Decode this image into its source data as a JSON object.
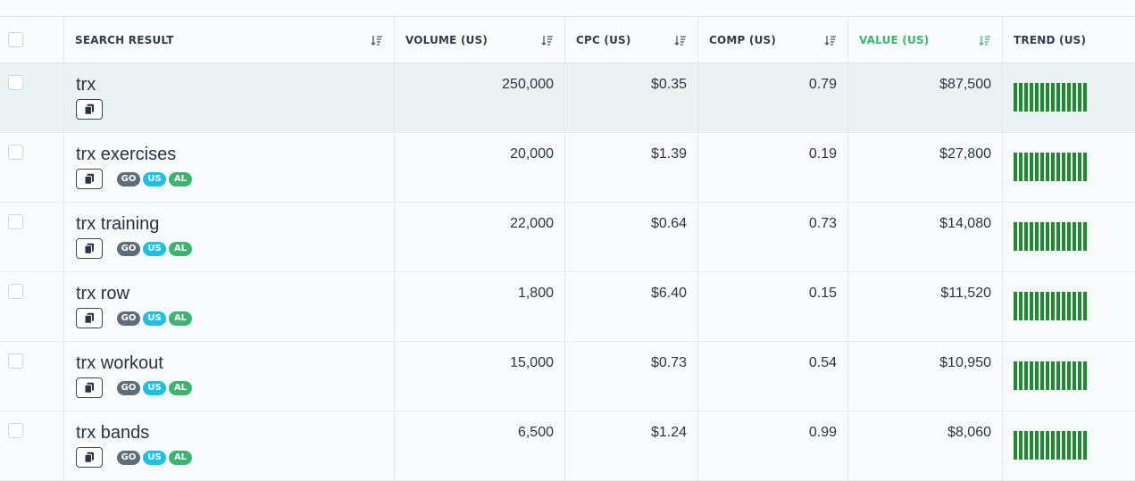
{
  "header": {
    "keyword": "SEARCH RESULT",
    "volume": "VOLUME (US)",
    "cpc": "CPC (US)",
    "comp": "COMP (US)",
    "value": "VALUE (US)",
    "trend": "TREND (US)"
  },
  "badge_labels": [
    "GO",
    "US",
    "AL"
  ],
  "colors": {
    "accent_green": "#3cb470",
    "trend_bar": "#1e8a2f",
    "badge_go": "#5f6d79",
    "badge_us": "#19c1e3",
    "badge_al": "#3cb470",
    "highlight_row": "#ecf2f4"
  },
  "rows": [
    {
      "keyword": "trx",
      "volume": "250,000",
      "cpc": "$0.35",
      "comp": "0.79",
      "value": "$87,500",
      "badges": false,
      "highlighted": true,
      "trend": [
        1,
        1,
        1,
        1,
        1,
        1,
        1,
        1,
        1,
        1,
        1,
        1,
        1,
        1
      ]
    },
    {
      "keyword": "trx exercises",
      "volume": "20,000",
      "cpc": "$1.39",
      "comp": "0.19",
      "value": "$27,800",
      "badges": true,
      "highlighted": false,
      "trend": [
        1,
        1,
        1,
        1,
        1,
        1,
        1,
        1,
        1,
        1,
        1,
        1,
        1,
        1
      ]
    },
    {
      "keyword": "trx training",
      "volume": "22,000",
      "cpc": "$0.64",
      "comp": "0.73",
      "value": "$14,080",
      "badges": true,
      "highlighted": false,
      "trend": [
        1,
        1,
        1,
        1,
        1,
        1,
        1,
        1,
        1,
        1,
        1,
        1,
        1,
        1
      ]
    },
    {
      "keyword": "trx row",
      "volume": "1,800",
      "cpc": "$6.40",
      "comp": "0.15",
      "value": "$11,520",
      "badges": true,
      "highlighted": false,
      "trend": [
        1,
        1,
        1,
        1,
        1,
        1,
        1,
        1,
        1,
        1,
        1,
        1,
        1,
        1
      ]
    },
    {
      "keyword": "trx workout",
      "volume": "15,000",
      "cpc": "$0.73",
      "comp": "0.54",
      "value": "$10,950",
      "badges": true,
      "highlighted": false,
      "trend": [
        1,
        1,
        1,
        1,
        1,
        1,
        1,
        1,
        1,
        1,
        1,
        1,
        1,
        1
      ]
    },
    {
      "keyword": "trx bands",
      "volume": "6,500",
      "cpc": "$1.24",
      "comp": "0.99",
      "value": "$8,060",
      "badges": true,
      "highlighted": false,
      "trend": [
        1,
        1,
        1,
        1,
        1,
        1,
        1,
        1,
        1,
        1,
        1,
        1,
        1,
        1
      ]
    }
  ]
}
